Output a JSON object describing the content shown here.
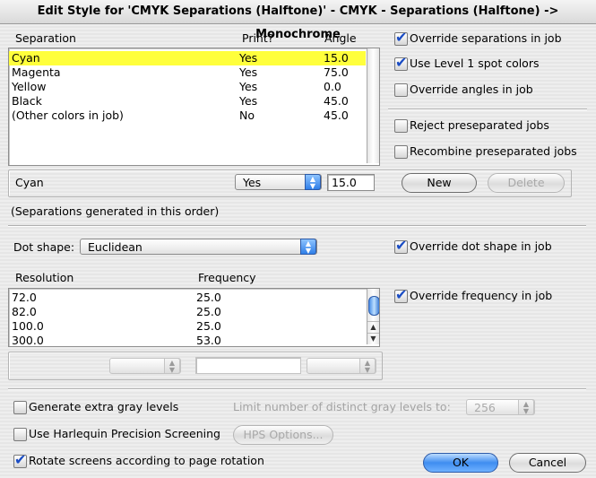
{
  "window": {
    "title": "Edit Style for 'CMYK Separations (Halftone)' - CMYK - Separations (Halftone) -> Monochrome"
  },
  "separations": {
    "headers": {
      "separation": "Separation",
      "print": "Print?",
      "angle": "Angle"
    },
    "rows": [
      {
        "name": "Cyan",
        "print": "Yes",
        "angle": "15.0",
        "selected": true
      },
      {
        "name": "Magenta",
        "print": "Yes",
        "angle": "75.0"
      },
      {
        "name": "Yellow",
        "print": "Yes",
        "angle": "0.0"
      },
      {
        "name": "Black",
        "print": "Yes",
        "angle": "45.0"
      },
      {
        "name": "(Other colors in job)",
        "print": "No",
        "angle": "45.0"
      }
    ],
    "editor": {
      "name": "Cyan",
      "print_value": "Yes",
      "angle_value": "15.0",
      "new_label": "New",
      "delete_label": "Delete"
    },
    "order_note": "(Separations generated in this order)"
  },
  "options_right": {
    "override_separations": {
      "label": "Override separations in job",
      "checked": true
    },
    "level1_spot": {
      "label": "Use Level 1 spot colors",
      "checked": true
    },
    "override_angles": {
      "label": "Override angles in job",
      "checked": false
    },
    "reject_presep": {
      "label": "Reject preseparated jobs",
      "checked": false
    },
    "recombine_presep": {
      "label": "Recombine preseparated jobs",
      "checked": false
    }
  },
  "dot": {
    "label": "Dot shape:",
    "value": "Euclidean",
    "override": {
      "label": "Override dot shape in job",
      "checked": true
    }
  },
  "frequency": {
    "headers": {
      "resolution": "Resolution",
      "frequency": "Frequency"
    },
    "rows": [
      {
        "resolution": "72.0",
        "frequency": "25.0"
      },
      {
        "resolution": "82.0",
        "frequency": "25.0"
      },
      {
        "resolution": "100.0",
        "frequency": "25.0"
      },
      {
        "resolution": "300.0",
        "frequency": "53.0"
      }
    ],
    "override": {
      "label": "Override frequency in job",
      "checked": true
    }
  },
  "bottom": {
    "extra_gray": {
      "label": "Generate extra gray levels",
      "checked": false
    },
    "limit_label": "Limit number of distinct gray levels to:",
    "limit_value": "256",
    "hps": {
      "label": "Use Harlequin Precision Screening",
      "checked": false
    },
    "hps_options_label": "HPS Options...",
    "rotate": {
      "label": "Rotate screens according to page rotation",
      "checked": true
    },
    "ok_label": "OK",
    "cancel_label": "Cancel"
  },
  "icons": {
    "check": "checkmark-icon",
    "popup_arrows": "updown-arrows-icon"
  },
  "colors": {
    "selection": "#ffff3c",
    "accent": "#3f8df0",
    "check": "#1a4cc4"
  }
}
